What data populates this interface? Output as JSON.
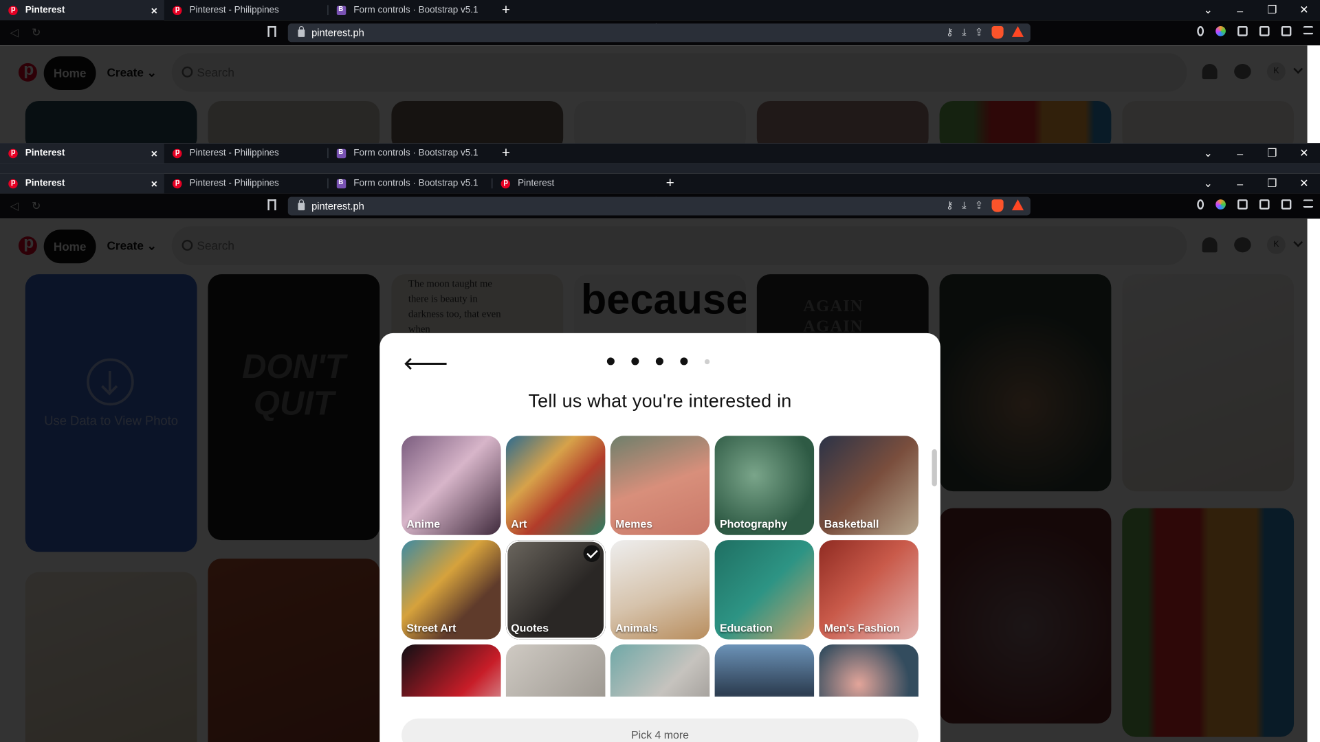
{
  "browser": {
    "tabs": [
      {
        "title": "Pinterest",
        "type": "pinterest",
        "active": true
      },
      {
        "title": "Pinterest - Philippines",
        "type": "pinterest",
        "active": false
      },
      {
        "title": "Form controls · Bootstrap v5.1",
        "type": "bootstrap",
        "active": false
      },
      {
        "title": "Pinterest",
        "type": "pinterest",
        "active": false
      }
    ],
    "url": "pinterest.ph"
  },
  "pinterest": {
    "home_label": "Home",
    "create_label": "Create",
    "search_placeholder": "Search",
    "avatar_initial": "K",
    "data_saver_text": "Use Data to View Photo",
    "pin_texts": {
      "dont_quit": "DON'T QUIT",
      "moon_quote": "The moon taught me there is beauty in darkness too, that even when",
      "because": "because",
      "again": "AGAIN AGAIN"
    }
  },
  "modal": {
    "title": "Tell us what you're interested in",
    "progress_total": 5,
    "progress_current": 4,
    "pick_button": "Pick 4 more",
    "topics": [
      {
        "label": "Anime",
        "selected": false,
        "bg": "linear-gradient(135deg,#7a5c7e,#d7b5c9 45%,#3f2a3c)"
      },
      {
        "label": "Art",
        "selected": false,
        "bg": "linear-gradient(135deg,#2d6b8f,#d7a24a 35%,#b23c2a 60%,#2e7d62)"
      },
      {
        "label": "Memes",
        "selected": false,
        "bg": "linear-gradient(160deg,#6e7f6b,#d88f7b 50%,#c97868)"
      },
      {
        "label": "Photography",
        "selected": false,
        "bg": "radial-gradient(circle at 40% 40%,#7aa58a,#2e5a44 70%)"
      },
      {
        "label": "Basketball",
        "selected": false,
        "bg": "linear-gradient(135deg,#2b3347,#7a4e3d 50%,#b5a58c)"
      },
      {
        "label": "Street Art",
        "selected": false,
        "bg": "linear-gradient(135deg,#3d8aa2,#d6a23c 40%,#5f3b2b 70%)"
      },
      {
        "label": "Quotes",
        "selected": true,
        "bg": "linear-gradient(135deg,#6c675f,#2a2725 60%)"
      },
      {
        "label": "Animals",
        "selected": false,
        "bg": "linear-gradient(160deg,#eee,#d6c3ac 55%,#b88d5d)"
      },
      {
        "label": "Education",
        "selected": false,
        "bg": "linear-gradient(135deg,#1f6f62,#2d9484 50%,#c9a36c)"
      },
      {
        "label": "Men's Fashion",
        "selected": false,
        "bg": "linear-gradient(135deg,#8f2b22,#c95a4a 45%,#e2b3b0)"
      },
      {
        "label": "",
        "selected": false,
        "bg": "linear-gradient(135deg,#0f0f14,#c81d28 55%,#ddd)"
      },
      {
        "label": "",
        "selected": false,
        "bg": "linear-gradient(135deg,#cfcac3,#8f8a83)"
      },
      {
        "label": "",
        "selected": false,
        "bg": "linear-gradient(135deg,#6fa8a7,#c6c3be 50%,#8b8682)"
      },
      {
        "label": "",
        "selected": false,
        "bg": "linear-gradient(180deg,#6c93b8,#2d3e52 50%,#c9d3da)"
      },
      {
        "label": "",
        "selected": false,
        "bg": "radial-gradient(circle at 40% 40%,#e3a59a,#334c5e 60%)"
      }
    ]
  },
  "colors": {
    "pinterest_red": "#e60023",
    "chrome_dark": "#0f1218",
    "toolbar": "#1e222a"
  }
}
